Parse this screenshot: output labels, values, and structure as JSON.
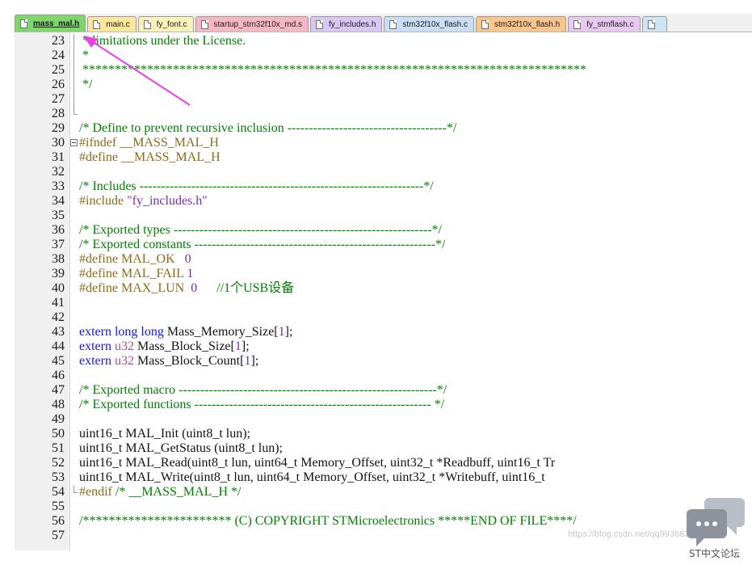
{
  "tabs": [
    {
      "label": "mass_mal.h",
      "color": "#7fd66a",
      "active": true
    },
    {
      "label": "main.c",
      "color": "#fbe79a",
      "active": false
    },
    {
      "label": "fy_font.c",
      "color": "#f9f2b8",
      "active": false
    },
    {
      "label": "startup_stm32f10x_md.s",
      "color": "#f6b7c4",
      "active": false
    },
    {
      "label": "fy_includes.h",
      "color": "#d9c6f2",
      "active": false
    },
    {
      "label": "stm32f10x_flash.c",
      "color": "#c9def2",
      "active": false
    },
    {
      "label": "stm32f10x_flash.h",
      "color": "#f8c58d",
      "active": false
    },
    {
      "label": "fy_stmflash.c",
      "color": "#e7c9f0",
      "active": false
    },
    {
      "label": "",
      "color": "#cde4f4",
      "active": false
    }
  ],
  "lines": [
    {
      "n": "23",
      "fold": "bar",
      "segs": [
        [
          "c-comment",
          " * limitations under the License."
        ]
      ]
    },
    {
      "n": "24",
      "fold": "bar",
      "segs": [
        [
          "c-comment",
          " *"
        ]
      ]
    },
    {
      "n": "25",
      "fold": "bar",
      "segs": [
        [
          "c-comment",
          " ******************************************************************************"
        ]
      ]
    },
    {
      "n": "26",
      "fold": "bar",
      "segs": [
        [
          "c-comment",
          " */"
        ]
      ]
    },
    {
      "n": "27",
      "fold": "bar",
      "segs": []
    },
    {
      "n": "28",
      "fold": "end",
      "segs": []
    },
    {
      "n": "29",
      "fold": "",
      "segs": [
        [
          "c-comment",
          "/* Define to prevent recursive inclusion -------------------------------------*/"
        ]
      ]
    },
    {
      "n": "30",
      "fold": "box",
      "segs": [
        [
          "c-prep",
          "#ifndef __MASS_MAL_H"
        ]
      ]
    },
    {
      "n": "31",
      "fold": "",
      "segs": [
        [
          "c-prep",
          "#define __MASS_MAL_H"
        ]
      ]
    },
    {
      "n": "32",
      "fold": "",
      "segs": []
    },
    {
      "n": "33",
      "fold": "",
      "segs": [
        [
          "c-comment",
          "/* Includes ------------------------------------------------------------------*/"
        ]
      ]
    },
    {
      "n": "34",
      "fold": "",
      "segs": [
        [
          "c-prep",
          "#include "
        ],
        [
          "c-str",
          "\"fy_includes.h\""
        ]
      ]
    },
    {
      "n": "35",
      "fold": "",
      "segs": []
    },
    {
      "n": "36",
      "fold": "",
      "segs": [
        [
          "c-comment",
          "/* Exported types ------------------------------------------------------------*/"
        ]
      ]
    },
    {
      "n": "37",
      "fold": "",
      "segs": [
        [
          "c-comment",
          "/* Exported constants --------------------------------------------------------*/"
        ]
      ]
    },
    {
      "n": "38",
      "fold": "",
      "segs": [
        [
          "c-prep",
          "#define MAL_OK   "
        ],
        [
          "c-num",
          "0"
        ]
      ]
    },
    {
      "n": "39",
      "fold": "",
      "segs": [
        [
          "c-prep",
          "#define MAL_FAIL "
        ],
        [
          "c-num",
          "1"
        ]
      ]
    },
    {
      "n": "40",
      "fold": "",
      "segs": [
        [
          "c-prep",
          "#define MAX_LUN  "
        ],
        [
          "c-num",
          "0"
        ],
        [
          "c-comment",
          "      //1个USB设备"
        ]
      ]
    },
    {
      "n": "41",
      "fold": "",
      "segs": []
    },
    {
      "n": "42",
      "fold": "",
      "segs": []
    },
    {
      "n": "43",
      "fold": "",
      "segs": [
        [
          "c-kw",
          "extern long long "
        ],
        [
          "c-plain",
          "Mass_Memory_Size["
        ],
        [
          "c-num",
          "1"
        ],
        [
          "c-plain",
          "];"
        ]
      ]
    },
    {
      "n": "44",
      "fold": "",
      "segs": [
        [
          "c-kw",
          "extern "
        ],
        [
          "c-type",
          "u32 "
        ],
        [
          "c-plain",
          "Mass_Block_Size["
        ],
        [
          "c-num",
          "1"
        ],
        [
          "c-plain",
          "];"
        ]
      ]
    },
    {
      "n": "45",
      "fold": "",
      "segs": [
        [
          "c-kw",
          "extern "
        ],
        [
          "c-type",
          "u32 "
        ],
        [
          "c-plain",
          "Mass_Block_Count["
        ],
        [
          "c-num",
          "1"
        ],
        [
          "c-plain",
          "];"
        ]
      ]
    },
    {
      "n": "46",
      "fold": "",
      "segs": []
    },
    {
      "n": "47",
      "fold": "",
      "segs": [
        [
          "c-comment",
          "/* Exported macro ------------------------------------------------------------*/"
        ]
      ]
    },
    {
      "n": "48",
      "fold": "",
      "segs": [
        [
          "c-comment",
          "/* Exported functions ------------------------------------------------------- */"
        ]
      ]
    },
    {
      "n": "49",
      "fold": "",
      "segs": []
    },
    {
      "n": "50",
      "fold": "",
      "segs": [
        [
          "c-plain",
          "uint16_t MAL_Init (uint8_t lun);"
        ]
      ]
    },
    {
      "n": "51",
      "fold": "",
      "segs": [
        [
          "c-plain",
          "uint16_t MAL_GetStatus (uint8_t lun);"
        ]
      ]
    },
    {
      "n": "52",
      "fold": "",
      "segs": [
        [
          "c-plain",
          "uint16_t MAL_Read(uint8_t lun, uint64_t Memory_Offset, uint32_t *Readbuff, uint16_t Tr"
        ]
      ]
    },
    {
      "n": "53",
      "fold": "",
      "segs": [
        [
          "c-plain",
          "uint16_t MAL_Write(uint8_t lun, uint64_t Memory_Offset, uint32_t *Writebuff, uint16_t"
        ]
      ]
    },
    {
      "n": "54",
      "fold": "end",
      "segs": [
        [
          "c-prep",
          "#endif "
        ],
        [
          "c-comment",
          "/* __MASS_MAL_H */"
        ]
      ]
    },
    {
      "n": "55",
      "fold": "",
      "segs": []
    },
    {
      "n": "56",
      "fold": "",
      "segs": [
        [
          "c-comment",
          "/*********************** (C) COPYRIGHT STMicroelectronics *****END OF FILE****/"
        ]
      ]
    },
    {
      "n": "57",
      "fold": "",
      "segs": []
    }
  ],
  "watermark": "https://blog.csdn.net/qq9936837457",
  "forum_label": "ST中文论坛",
  "colors": {
    "comment": "#008000",
    "preprocessor": "#8b6a18",
    "keyword": "#1515d8",
    "number": "#7a2bb0",
    "arrow": "#ee3bea"
  }
}
